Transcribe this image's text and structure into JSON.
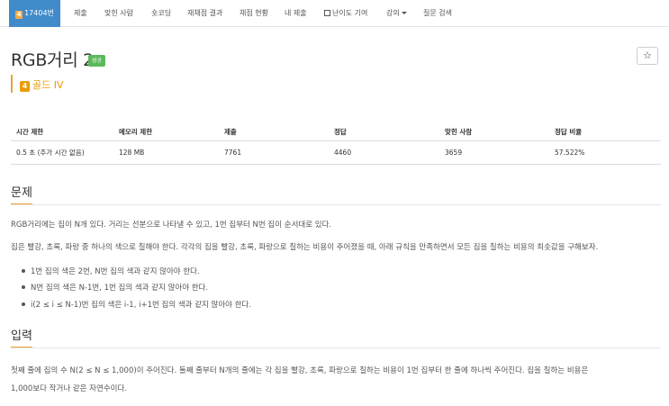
{
  "nav": {
    "problem_number": "17404번",
    "tier_mini": "4",
    "items": [
      "제출",
      "맞힌 사람",
      "숏코딩",
      "재채점 결과",
      "채점 현황",
      "내 제출",
      "난이도 기여",
      "강의",
      "질문 검색"
    ]
  },
  "problem": {
    "title": "RGB거리 2",
    "result_badge": "성공",
    "star_label": "☆",
    "tier_icon_number": "4",
    "tier_label": "골드 IV"
  },
  "info_table": {
    "headers": [
      "시간 제한",
      "메모리 제한",
      "제출",
      "정답",
      "맞힌 사람",
      "정답 비율"
    ],
    "values": [
      "0.5 초 (추가 시간 없음)",
      "128 MB",
      "7761",
      "4460",
      "3659",
      "57.522%"
    ]
  },
  "sections": {
    "problem": {
      "heading": "문제",
      "p1": "RGB거리에는 집이 N개 있다. 거리는 선분으로 나타낼 수 있고, 1번 집부터 N번 집이 순서대로 있다.",
      "p2": "집은 빨강, 초록, 파랑 중 하나의 색으로 칠해야 한다. 각각의 집을 빨강, 초록, 파랑으로 칠하는 비용이 주어졌을 때, 아래 규칙을 만족하면서 모든 집을 칠하는 비용의 최솟값을 구해보자.",
      "rules": [
        "1번 집의 색은 2번, N번 집의 색과 같지 않아야 한다.",
        "N번 집의 색은 N-1번, 1번 집의 색과 같지 않아야 한다.",
        "i(2 ≤ i ≤ N-1)번 집의 색은 i-1, i+1번 집의 색과 같지 않아야 한다."
      ]
    },
    "input": {
      "heading": "입력",
      "line1": "첫째 줄에 집의 수 N(2 ≤ N ≤ 1,000)이 주어진다. 둘째 줄부터 N개의 줄에는 각 집을 빨강, 초록, 파랑으로 칠하는 비용이 1번 집부터 한 줄에 하나씩 주어진다. 집을 칠하는 비용은",
      "line2": "1,000보다 작거나 같은 자연수이다."
    }
  },
  "colors": {
    "nav_active": "#428bca",
    "tier_gold": "#ec9a00",
    "success": "#5cb85c"
  }
}
